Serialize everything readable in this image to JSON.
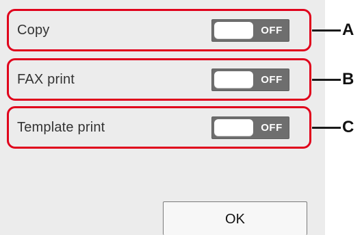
{
  "settings": [
    {
      "label": "Copy",
      "toggle_state": "OFF",
      "callout": "A"
    },
    {
      "label": "FAX print",
      "toggle_state": "OFF",
      "callout": "B"
    },
    {
      "label": "Template print",
      "toggle_state": "OFF",
      "callout": "C"
    }
  ],
  "ok_button": {
    "label": "OK"
  },
  "colors": {
    "highlight_border": "#e0001b",
    "toggle_off": "#6e6e6e",
    "screen_background": "#ececec"
  }
}
